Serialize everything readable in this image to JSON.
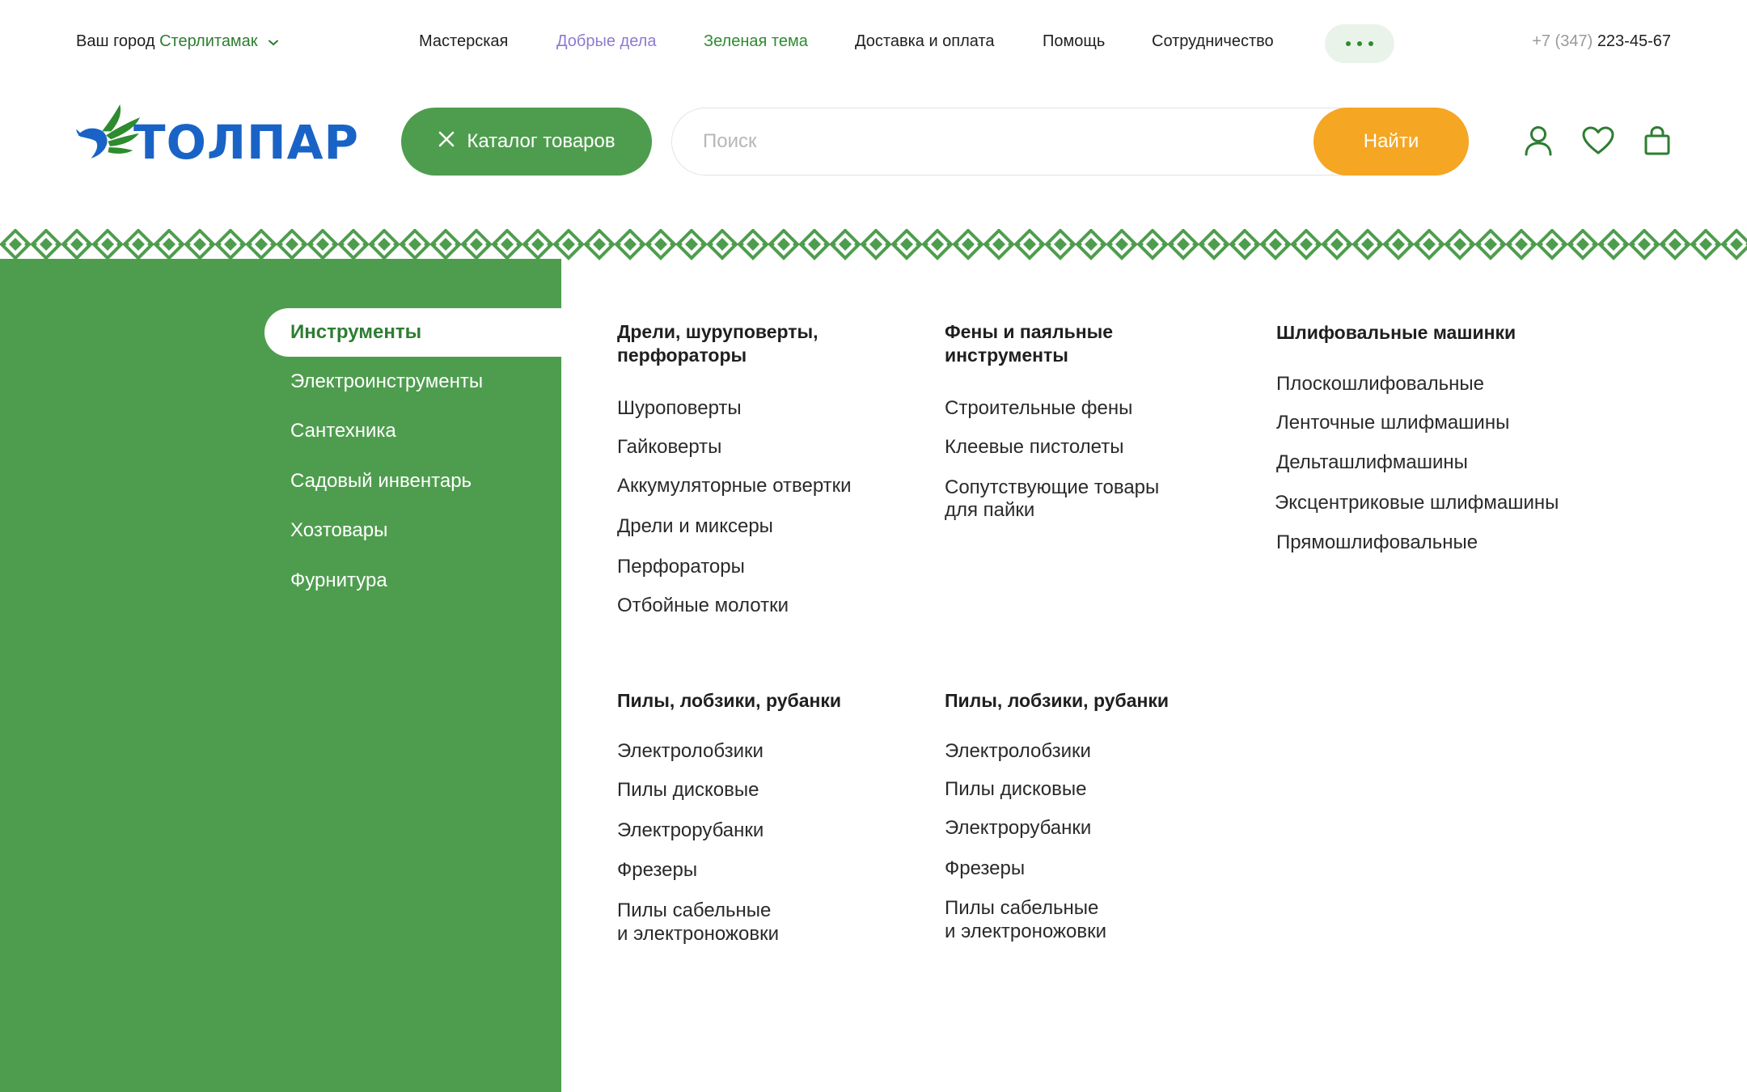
{
  "topbar": {
    "city_prefix": "Ваш город",
    "city_name": "Стерлитамак",
    "nav": [
      "Мастерская",
      "Добрые дела",
      "Зеленая тема",
      "Доставка и оплата",
      "Помощь",
      "Сотрудничество"
    ],
    "phone_code": "+7 (347)",
    "phone_number": "223-45-67"
  },
  "header": {
    "logo_text": "ТОЛПАР",
    "catalog_label": "Каталог товаров",
    "search_placeholder": "Поиск",
    "search_button": "Найти"
  },
  "colors": {
    "brand_green": "#4e9d4e",
    "accent_orange": "#f5a623",
    "logo_blue": "#1a63c6",
    "active_green": "#2e7d32"
  },
  "icons": [
    "chevron-down-icon",
    "close-icon",
    "user-icon",
    "heart-icon",
    "bag-icon",
    "more-dots-icon"
  ],
  "sidebar": {
    "items": [
      "Инструменты",
      "Электроинструменты",
      "Сантехника",
      "Садовый инвентарь",
      "Хозтовары",
      "Фурнитура"
    ],
    "active_index": 0
  },
  "menu": {
    "groups": [
      {
        "heading": [
          "Дрели, шуруповерты,",
          "перфораторы"
        ],
        "links": [
          "Шуроповерты",
          "Гайковерты",
          "Аккумуляторные отвертки",
          "Дрели и миксеры",
          "Перфораторы",
          "Отбойные молотки"
        ]
      },
      {
        "heading": [
          "Фены и паяльные",
          "инструменты"
        ],
        "links": [
          "Строительные фены",
          "Клеевые пистолеты",
          "Сопутствующие товары",
          "для пайки"
        ]
      },
      {
        "heading": [
          "Шлифовальные машинки"
        ],
        "links": [
          "Плоскошлифовальные",
          "Ленточные шлифмашины",
          "Дельташлифмашины",
          "Эксцентриковые шлифмашины",
          "Прямошлифовальные"
        ]
      },
      {
        "heading": [
          "Пилы, лобзики, рубанки"
        ],
        "links": [
          "Электролобзики",
          "Пилы дисковые",
          "Электрорубанки",
          "Фрезеры",
          "Пилы сабельные",
          "и электроножовки"
        ]
      },
      {
        "heading": [
          "Пилы, лобзики, рубанки"
        ],
        "links": [
          "Электролобзики",
          "Пилы дисковые",
          "Электрорубанки",
          "Фрезеры",
          "Пилы сабельные",
          "и электроножовки"
        ]
      }
    ]
  }
}
